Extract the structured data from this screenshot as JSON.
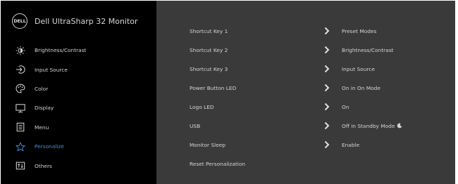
{
  "brand": {
    "logo_text": "DELL",
    "title": "Dell UltraSharp 32 Monitor"
  },
  "menu": [
    {
      "label": "Brightness/Contrast",
      "icon": "brightness-icon",
      "active": false
    },
    {
      "label": "Input Source",
      "icon": "input-source-icon",
      "active": false
    },
    {
      "label": "Color",
      "icon": "color-palette-icon",
      "active": false
    },
    {
      "label": "Display",
      "icon": "display-icon",
      "active": false
    },
    {
      "label": "Menu",
      "icon": "menu-icon",
      "active": false
    },
    {
      "label": "Personalize",
      "icon": "star-icon",
      "active": true
    },
    {
      "label": "Others",
      "icon": "others-icon",
      "active": false
    }
  ],
  "settings": [
    {
      "label": "Shortcut Key 1",
      "value": "Preset Modes"
    },
    {
      "label": "Shortcut Key 2",
      "value": "Brightness/Contrast"
    },
    {
      "label": "Shortcut Key 3",
      "value": "Input Source"
    },
    {
      "label": "Power Button LED",
      "value": "On in On Mode"
    },
    {
      "label": "Logo LED",
      "value": "On"
    },
    {
      "label": "USB",
      "value": "Off in Standby Mode",
      "value_icon": "moon-icon"
    },
    {
      "label": "Monitor Sleep",
      "value": "Enable"
    },
    {
      "label": "Reset Personalization",
      "value": ""
    }
  ],
  "colors": {
    "accent": "#3d8fe0",
    "sidebar_bg": "#000000",
    "panel_bg": "#3a3a3a",
    "text": "#d4d4d4"
  }
}
